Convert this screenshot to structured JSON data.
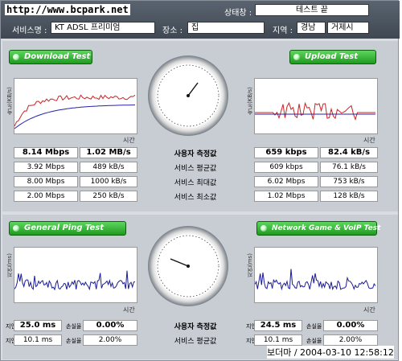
{
  "header": {
    "brand": "http://www.bcpark.net",
    "status_label": "상태창 :",
    "status_value": "테스트 끝",
    "service_label": "서비스명 :",
    "service_value": "KT ADSL 프리미엄",
    "place_label": "장소 :",
    "place_value": "집",
    "region_label": "지역 :",
    "region_value": "경남",
    "region_city": "거제시"
  },
  "download": {
    "button": "Download Test",
    "axis_y": "속도(KB/s)",
    "axis_x": "시간",
    "rows": [
      [
        "8.14 Mbps",
        "1.02 MB/s"
      ],
      [
        "3.92 Mbps",
        "489 kB/s"
      ],
      [
        "8.00 Mbps",
        "1000 kB/s"
      ],
      [
        "2.00 Mbps",
        "250 kB/s"
      ]
    ]
  },
  "upload": {
    "button": "Upload Test",
    "axis_y": "속도(KB/s)",
    "axis_x": "시간",
    "rows": [
      [
        "659 kbps",
        "82.4 kB/s"
      ],
      [
        "609 kbps",
        "76.1 kB/s"
      ],
      [
        "6.02 Mbps",
        "753 kB/s"
      ],
      [
        "1.02 Mbps",
        "128 kB/s"
      ]
    ]
  },
  "speed_labels": [
    "사용자 측정값",
    "서비스 평균값",
    "서비스 최대값",
    "서비스 최소값"
  ],
  "ping": {
    "button": "General Ping Test",
    "axis_y": "지연(ms)",
    "axis_x": "시간",
    "delay": "25.0 ms",
    "loss": "0.00%",
    "avg_delay": "10.1 ms",
    "avg_loss": "2.00%",
    "side_top_1": "지연",
    "side_bottom_1": "손실율",
    "side_top_2": "지연",
    "side_bottom_2": "손실율"
  },
  "game": {
    "button": "Network Game & VoIP Test",
    "axis_y": "지연(ms)",
    "axis_x": "시간",
    "delay": "24.5 ms",
    "loss": "0.00%",
    "avg_delay": "10.1 ms",
    "avg_loss": "2.00%",
    "side_top_1": "지연",
    "side_bottom_1": "손실율",
    "side_top_2": "지연",
    "side_bottom_2": "손실율"
  },
  "ping_labels": [
    "사용자 측정값",
    "서비스 평균값"
  ],
  "footer": "보더마 / 2004-03-10 12:58:12",
  "colors": {
    "accent_green": "#1f9a1f",
    "download_line": "#cc2222",
    "avg_line": "#2222aa",
    "ping_line": "#1a1a9a"
  }
}
